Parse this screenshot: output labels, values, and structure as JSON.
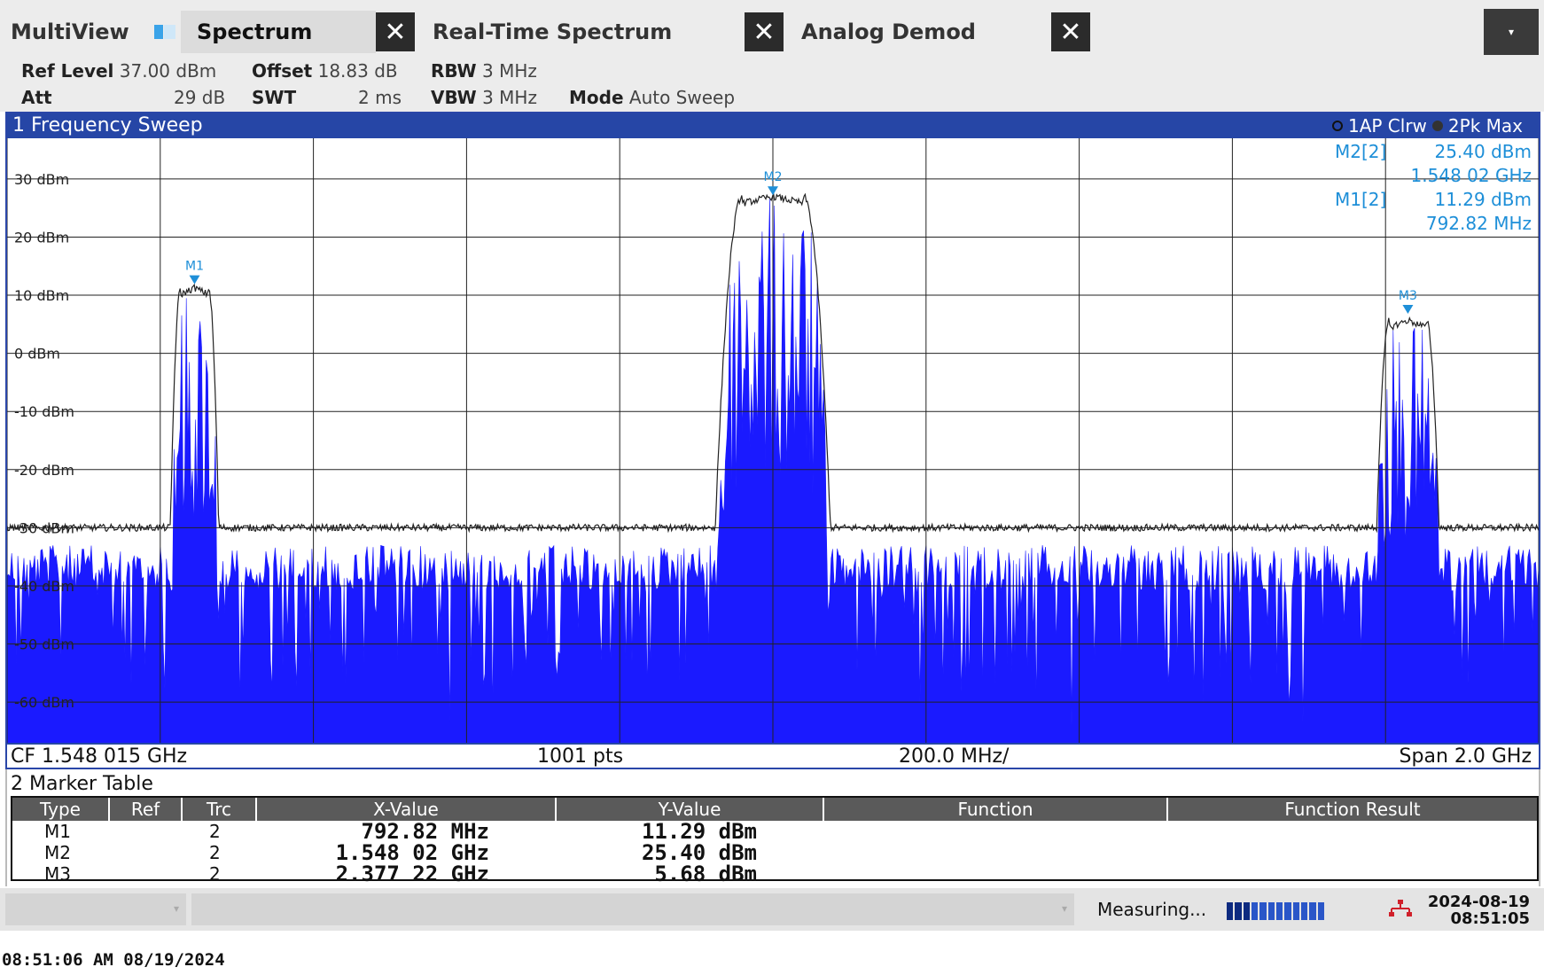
{
  "tabs": {
    "multiview": "MultiView",
    "spectrum": "Spectrum",
    "rts": "Real-Time Spectrum",
    "demod": "Analog Demod",
    "close_symbol": "✕",
    "menu_symbol": "▾"
  },
  "settings": {
    "ref_level_label": "Ref Level",
    "ref_level_value": "37.00 dBm",
    "offset_label": "Offset",
    "offset_value": "18.83 dB",
    "rbw_label": "RBW",
    "rbw_value": "3 MHz",
    "att_label": "Att",
    "att_value": "29 dB",
    "swt_label": "SWT",
    "swt_value": "2 ms",
    "vbw_label": "VBW",
    "vbw_value": "3 MHz",
    "mode_label": "Mode",
    "mode_value": "Auto Sweep"
  },
  "sweep": {
    "title": "1 Frequency Sweep",
    "trace1_label": "1AP Clrw",
    "trace2_label": "2Pk Max",
    "marker_readout": [
      {
        "label": "M2[2]",
        "y": "25.40 dBm",
        "x": "1.548 02 GHz"
      },
      {
        "label": "M1[2]",
        "y": "11.29 dBm",
        "x": "792.82 MHz"
      }
    ],
    "footer_cf": "CF 1.548 015 GHz",
    "footer_pts": "1001 pts",
    "footer_div": "200.0 MHz/",
    "footer_span": "Span 2.0 GHz"
  },
  "chart_data": {
    "type": "line",
    "x_unit": "GHz",
    "y_unit": "dBm",
    "xlim": [
      0.548015,
      2.548015
    ],
    "ylim": [
      -67,
      37
    ],
    "yticks": [
      30,
      20,
      10,
      0,
      -10,
      -20,
      -30,
      -40,
      -50,
      -60
    ],
    "ytick_labels": [
      "30 dBm",
      "20 dBm",
      "10 dBm",
      "0 dBm",
      "-10 dBm",
      "-20 dBm",
      "-30 dBm",
      "-40 dBm",
      "-50 dBm",
      "-60 dBm"
    ],
    "grid": true,
    "reference_line_dbm": -30,
    "noise_floor_pk_dbm": -30,
    "series": [
      {
        "name": "1AP Clrw",
        "color": "#1a1aff"
      },
      {
        "name": "2Pk Max",
        "color": "#222222",
        "peaks": [
          {
            "x": 0.79282,
            "y": 11.29,
            "width": 0.045
          },
          {
            "x": 1.54802,
            "y": 27,
            "width": 0.1
          },
          {
            "x": 2.37722,
            "y": 5.68,
            "width": 0.06
          }
        ]
      }
    ],
    "markers": [
      {
        "name": "M1",
        "x": 0.79282,
        "y": 11.29
      },
      {
        "name": "M2",
        "x": 1.54802,
        "y": 25.4
      },
      {
        "name": "M3",
        "x": 2.37722,
        "y": 5.68
      }
    ],
    "marker_color": "#1e8fd8"
  },
  "marker_table": {
    "title": "2 Marker Table",
    "headers": [
      "Type",
      "Ref",
      "Trc",
      "X-Value",
      "Y-Value",
      "Function",
      "Function Result"
    ],
    "rows": [
      {
        "type": "M1",
        "ref": "",
        "trc": "2",
        "x": "792.82 MHz",
        "y": "11.29 dBm",
        "func": "",
        "result": ""
      },
      {
        "type": "M2",
        "ref": "",
        "trc": "2",
        "x": "1.548 02 GHz",
        "y": "25.40 dBm",
        "func": "",
        "result": ""
      },
      {
        "type": "M3",
        "ref": "",
        "trc": "2",
        "x": "2.377 22 GHz",
        "y": "5.68 dBm",
        "func": "",
        "result": ""
      }
    ]
  },
  "status": {
    "measuring": "Measuring...",
    "date": "2024-08-19",
    "time": "08:51:05",
    "progress_total": 12,
    "progress_done": 3
  },
  "bottom": {
    "timestamp": "08:51:06 AM  08/19/2024"
  }
}
